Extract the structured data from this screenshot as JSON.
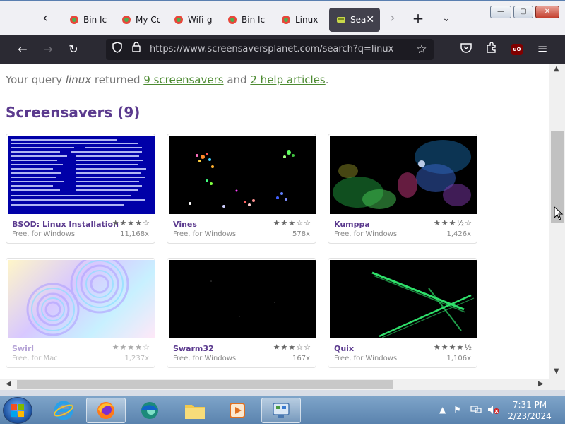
{
  "tabs": [
    {
      "label": "Bin Ic",
      "active": false
    },
    {
      "label": "My Co",
      "active": false
    },
    {
      "label": "Wifi-g",
      "active": false
    },
    {
      "label": "Bin Ic",
      "active": false
    },
    {
      "label": "Linux",
      "active": false
    },
    {
      "label": "Sea",
      "active": true
    }
  ],
  "window_controls": {
    "minimize": "—",
    "maximize": "▢",
    "close": "✕"
  },
  "toolbar": {
    "url": "https://www.screensaversplanet.com/search?q=linux",
    "ublock_badge": "uO"
  },
  "page": {
    "query_prefix": "Your query",
    "query_term": "linux",
    "query_mid": "returned",
    "screensavers_link": "9 screensavers",
    "and_text": "and",
    "help_link": "2 help articles",
    "period": ".",
    "section_title": "Screensavers (9)"
  },
  "cards": [
    {
      "title": "BSOD: Linux Installation",
      "subtitle": "Free, for Windows",
      "count": "11,168x",
      "stars": "★★★★☆"
    },
    {
      "title": "Vines",
      "subtitle": "Free, for Windows",
      "count": "578x",
      "stars": "★★★☆☆"
    },
    {
      "title": "Kumppa",
      "subtitle": "Free, for Windows",
      "count": "1,426x",
      "stars": "★★★½☆"
    },
    {
      "title": "Swirl",
      "subtitle": "Free, for Mac",
      "count": "1,237x",
      "stars": "★★★★☆"
    },
    {
      "title": "Swarm32",
      "subtitle": "Free, for Windows",
      "count": "167x",
      "stars": "★★★☆☆"
    },
    {
      "title": "Quix",
      "subtitle": "Free, for Windows",
      "count": "1,106x",
      "stars": "★★★★½"
    }
  ],
  "taskbar": {
    "time": "7:31 PM",
    "date": "2/23/2024"
  },
  "colors": {
    "accent_purple": "#5b3a8e",
    "link_green": "#4d8b32",
    "toolbar_dark": "#2b2a33"
  }
}
